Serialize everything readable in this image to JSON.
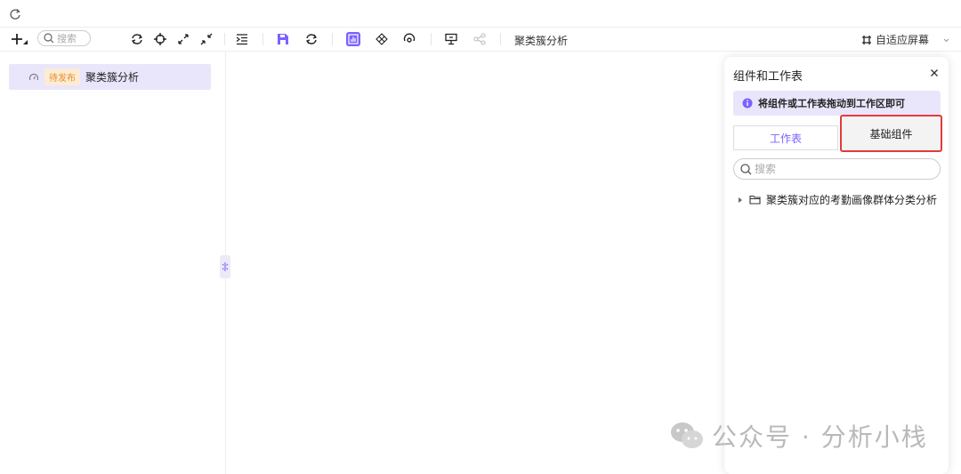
{
  "toolbar": {
    "search_placeholder": "搜索",
    "report_title": "聚类簇分析",
    "fit_screen_label": "自适应屏幕",
    "active_color": "#7b61ff"
  },
  "left_panel": {
    "items": [
      {
        "badge": "待发布",
        "label": "聚类簇分析"
      }
    ]
  },
  "panel": {
    "title": "组件和工作表",
    "info": "将组件或工作表拖动到工作区即可",
    "tabs": [
      {
        "label": "工作表",
        "active": true
      },
      {
        "label": "基础组件",
        "active": false
      }
    ],
    "search_placeholder": "搜索",
    "tree": [
      {
        "label": "聚类簇对应的考勤画像群体分类分析",
        "icon": "folder-icon"
      }
    ]
  },
  "watermark": {
    "text": "公众号 · 分析小栈"
  }
}
